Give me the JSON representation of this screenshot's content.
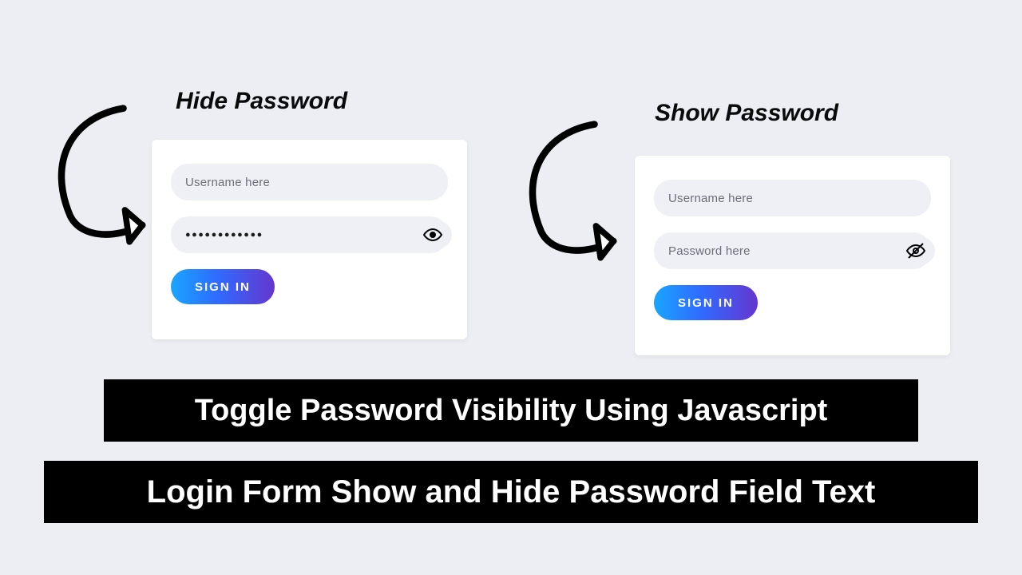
{
  "headings": {
    "left": "Hide Password",
    "right": "Show Password"
  },
  "left_card": {
    "username_placeholder": "Username here",
    "password_masked": "●●●●●●●●●●●●",
    "signin_label": "SIGN IN"
  },
  "right_card": {
    "username_placeholder": "Username here",
    "password_placeholder": "Password here",
    "signin_label": "SIGN IN"
  },
  "banners": {
    "line1": "Toggle Password Visibility Using Javascript",
    "line2": "Login Form Show and Hide Password Field Text"
  }
}
